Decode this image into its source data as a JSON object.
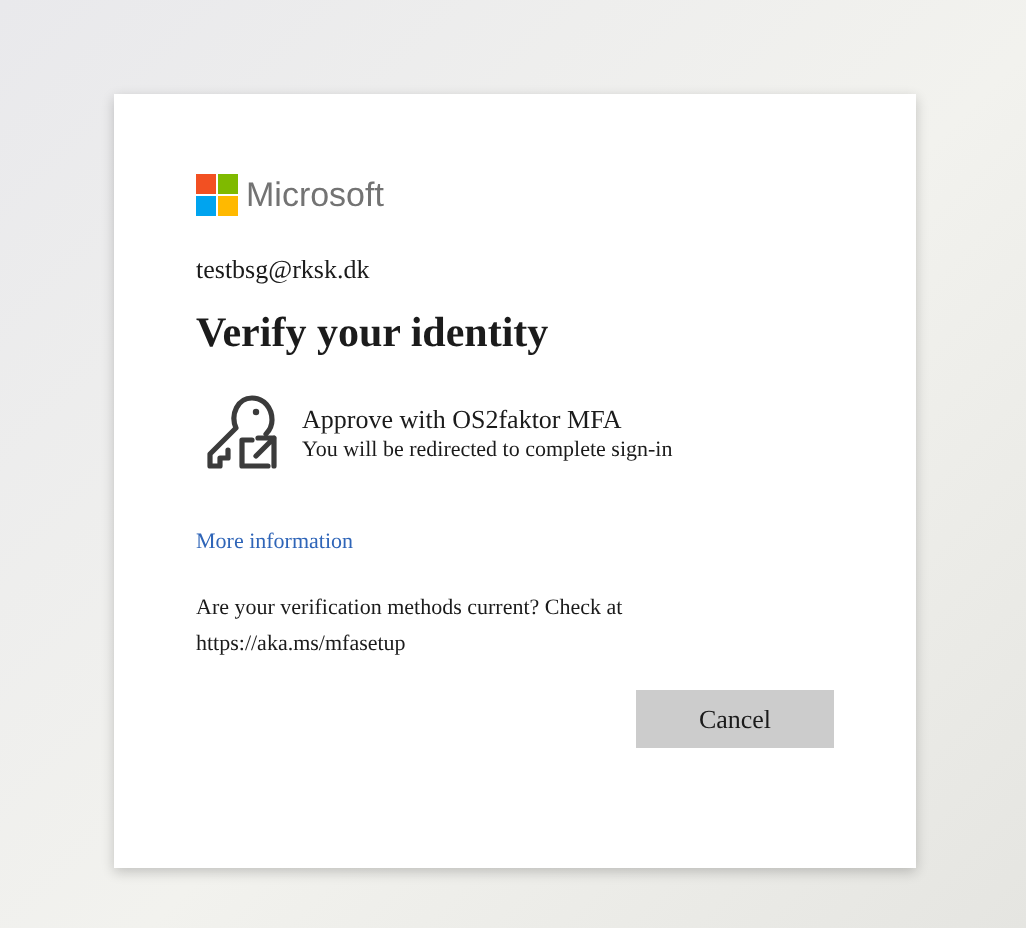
{
  "brand": {
    "name": "Microsoft"
  },
  "account": "testbsg@rksk.dk",
  "title": "Verify your identity",
  "method": {
    "title": "Approve with OS2faktor MFA",
    "subtitle": "You will be redirected to complete sign-in"
  },
  "more_info_link": "More information",
  "notice": "Are your verification methods current? Check at https://aka.ms/mfasetup",
  "buttons": [
    "Cancel"
  ]
}
